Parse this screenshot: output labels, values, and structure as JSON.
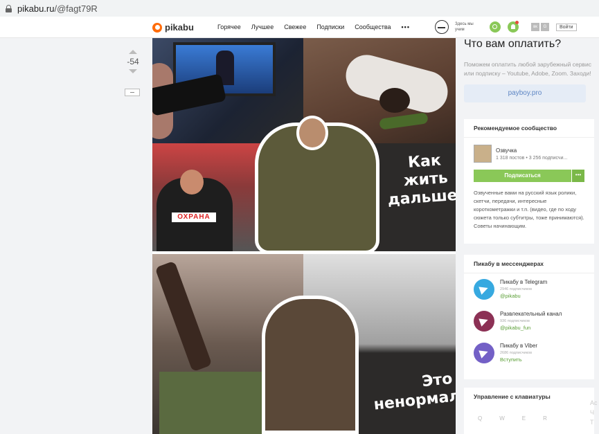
{
  "browser": {
    "url_host": "pikabu.ru",
    "url_path": "/@fagt79R"
  },
  "header": {
    "logo": "pikabu",
    "nav": [
      "Горячее",
      "Лучшее",
      "Свежее",
      "Подписки",
      "Сообщества"
    ],
    "more": "•••",
    "here": "Здесь мы учим",
    "social": [
      "вк",
      "G"
    ],
    "login": "Войти"
  },
  "post": {
    "rating": "-54",
    "caption1": "Как\nжить\nдальше?",
    "caption2": "Это\nненормально!!",
    "guard_label": "ОХРАНА"
  },
  "sidebar": {
    "ad_title": "Что вам оплатить?",
    "ad_text": "Поможем оплатить любой зарубежный сервис или подписку – Youtube, Adobe, Zoom. Заходи!",
    "ad_button": "payboy.pro",
    "recommended": {
      "title": "Рекомендуемое сообщество",
      "name": "Озвучка",
      "stats": "1 318 постов • 3 256 подписчи...",
      "subscribe": "Подписаться",
      "more": "•••",
      "description": "Озвученные вами на русский язык ролики, скетчи, передачи, интересные короткометражки и т.п. (видео, где по ходу сюжета только субтитры, тоже принимаются). Советы начинающим."
    },
    "messengers": {
      "title": "Пикабу в мессенджерах",
      "items": [
        {
          "name": "Пикабу в Telegram",
          "count": "2946 подписчиков",
          "link": "@pikabu",
          "color": "#37a9e0"
        },
        {
          "name": "Развлекательный канал",
          "count": "936 подписчиков",
          "link": "@pikabu_fun",
          "color": "#8c3155"
        },
        {
          "name": "Пикабу в Viber",
          "count": "2686 подписчиков",
          "link": "Вступить",
          "color": "#7360c6"
        }
      ]
    },
    "keyboard": {
      "title": "Управление с клавиатуры",
      "keys": [
        "Q",
        "W",
        "E",
        "R"
      ]
    },
    "edge_text": [
      "Ac",
      "Ч",
      "T"
    ]
  }
}
